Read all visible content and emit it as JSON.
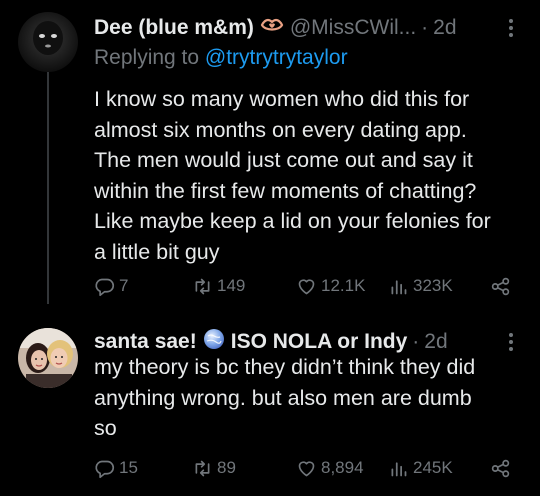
{
  "tweets": [
    {
      "name": "Dee (blue m&m)",
      "name_badge_icon": "lips-heart-icon",
      "handle": "@MissCWil...",
      "separator": "·",
      "time": "2d",
      "replying_prefix": "Replying to",
      "replying_to": "@trytrytrytaylor",
      "text": "I know so many women who did this for\nalmost six months on every dating app.\nThe men would just come out and say it\nwithin the first few moments of chatting?\nLike maybe keep a lid on your felonies for\na little bit guy",
      "replies": "7",
      "retweets": "149",
      "likes": "12.1K",
      "views": "323K"
    },
    {
      "name": "santa sae!",
      "name_badge_icon": "globe-icon",
      "name_suffix": "ISO NOLA or Indy",
      "separator": "·",
      "time": "2d",
      "text": "my theory is bc they didn’t think they did\nanything wrong. but also men are dumb\nso",
      "replies": "15",
      "retweets": "89",
      "likes": "8,894",
      "views": "245K"
    }
  ],
  "colors": {
    "background": "#000000",
    "text": "#e7e9ea",
    "muted": "#71767b",
    "link": "#1d9bf0",
    "thread_line": "#333639"
  }
}
